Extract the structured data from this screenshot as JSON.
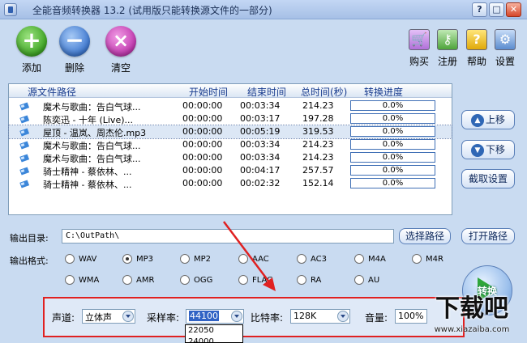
{
  "window": {
    "title": "全能音频转换器 13.2 (试用版只能转换源文件的一部分)",
    "minimize_glyph": "?",
    "maximize_glyph": "□",
    "close_glyph": "✕"
  },
  "toolbar": {
    "add_label": "添加",
    "delete_label": "删除",
    "clear_label": "清空",
    "buy_label": "购买",
    "register_label": "注册",
    "help_label": "帮助",
    "settings_label": "设置"
  },
  "table": {
    "headers": {
      "path": "源文件路径",
      "start": "开始时间",
      "end": "结束时间",
      "total": "总时间(秒)",
      "progress": "转换进度"
    },
    "rows": [
      {
        "name": "魔术与歌曲：告白气球...",
        "start": "00:00:00",
        "end": "00:03:34",
        "total": "214.23",
        "progress": "0.0%"
      },
      {
        "name": "陈奕迅 - 十年 (Live)...",
        "start": "00:00:00",
        "end": "00:03:17",
        "total": "197.28",
        "progress": "0.0%"
      },
      {
        "name": "屋顶 - 温岚、周杰伦.mp3",
        "start": "00:00:00",
        "end": "00:05:19",
        "total": "319.53",
        "progress": "0.0%"
      },
      {
        "name": "魔术与歌曲：告白气球...",
        "start": "00:00:00",
        "end": "00:03:34",
        "total": "214.23",
        "progress": "0.0%"
      },
      {
        "name": "魔术与歌曲：告白气球...",
        "start": "00:00:00",
        "end": "00:03:34",
        "total": "214.23",
        "progress": "0.0%"
      },
      {
        "name": "骑士精神 - 蔡依林、...",
        "start": "00:00:00",
        "end": "00:04:17",
        "total": "257.57",
        "progress": "0.0%"
      },
      {
        "name": "骑士精神 - 蔡依林、...",
        "start": "00:00:00",
        "end": "00:02:32",
        "total": "152.14",
        "progress": "0.0%"
      }
    ]
  },
  "side": {
    "up_label": "上移",
    "down_label": "下移",
    "cut_label": "截取设置",
    "open_path_label": "打开路径",
    "convert_label": "转换"
  },
  "output": {
    "dir_label": "输出目录:",
    "dir_value": "C:\\OutPath\\",
    "choose_label": "选择路径",
    "format_label": "输出格式:"
  },
  "formats": {
    "row1": [
      "WAV",
      "MP3",
      "MP2",
      "AAC",
      "AC3",
      "M4A",
      "M4R"
    ],
    "row2": [
      "WMA",
      "AMR",
      "OGG",
      "FLAC",
      "RA",
      "AU"
    ],
    "selected": "MP3"
  },
  "params": {
    "channel_label": "声道:",
    "channel_value": "立体声",
    "rate_label": "采样率:",
    "rate_value": "44100",
    "bitrate_label": "比特率:",
    "bitrate_value": "128K",
    "volume_label": "音量:",
    "volume_value": "100%",
    "rate_options": [
      "22050",
      "24000"
    ]
  },
  "watermark": {
    "big": "下载吧",
    "small": "www.xiazaiba.com"
  }
}
